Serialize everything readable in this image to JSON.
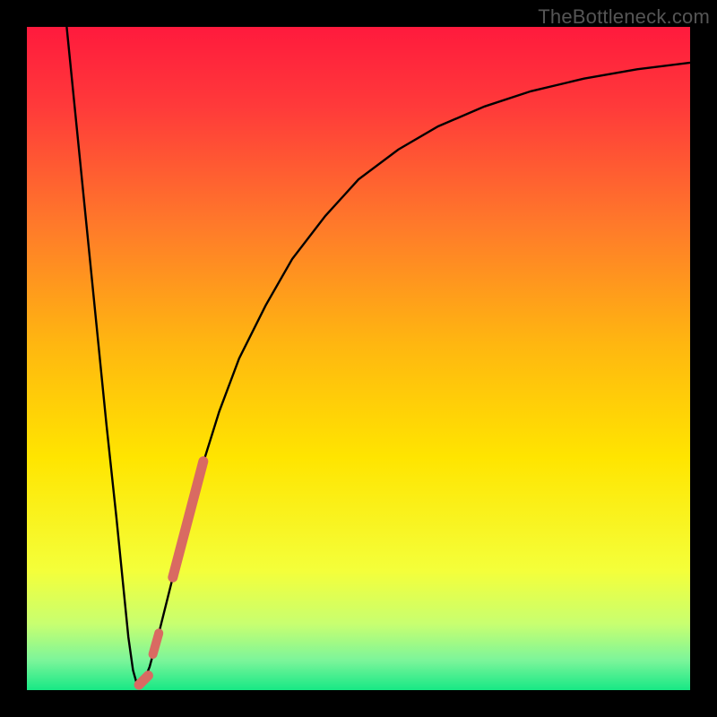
{
  "watermark": "TheBottleneck.com",
  "chart_data": {
    "type": "line",
    "title": "",
    "xlabel": "",
    "ylabel": "",
    "xlim": [
      0,
      100
    ],
    "ylim": [
      0,
      100
    ],
    "background_gradient": {
      "stops": [
        {
          "offset": 0.0,
          "color": "#ff1a3d"
        },
        {
          "offset": 0.12,
          "color": "#ff3a3a"
        },
        {
          "offset": 0.3,
          "color": "#ff7a2a"
        },
        {
          "offset": 0.48,
          "color": "#ffb710"
        },
        {
          "offset": 0.65,
          "color": "#ffe500"
        },
        {
          "offset": 0.82,
          "color": "#f4ff3a"
        },
        {
          "offset": 0.9,
          "color": "#c8ff70"
        },
        {
          "offset": 0.955,
          "color": "#7cf59a"
        },
        {
          "offset": 1.0,
          "color": "#17e885"
        }
      ]
    },
    "series": [
      {
        "name": "bottleneck-curve",
        "stroke": "#000000",
        "stroke_width": 2.4,
        "points": [
          {
            "x": 6.0,
            "y": 100.0
          },
          {
            "x": 7.5,
            "y": 85.0
          },
          {
            "x": 9.0,
            "y": 70.0
          },
          {
            "x": 10.5,
            "y": 55.0
          },
          {
            "x": 12.0,
            "y": 40.0
          },
          {
            "x": 13.5,
            "y": 26.0
          },
          {
            "x": 14.5,
            "y": 16.0
          },
          {
            "x": 15.3,
            "y": 8.0
          },
          {
            "x": 16.0,
            "y": 3.0
          },
          {
            "x": 16.7,
            "y": 0.5
          },
          {
            "x": 17.5,
            "y": 1.0
          },
          {
            "x": 18.5,
            "y": 3.5
          },
          {
            "x": 20.0,
            "y": 9.0
          },
          {
            "x": 22.0,
            "y": 17.0
          },
          {
            "x": 24.0,
            "y": 25.0
          },
          {
            "x": 26.5,
            "y": 34.0
          },
          {
            "x": 29.0,
            "y": 42.0
          },
          {
            "x": 32.0,
            "y": 50.0
          },
          {
            "x": 36.0,
            "y": 58.0
          },
          {
            "x": 40.0,
            "y": 65.0
          },
          {
            "x": 45.0,
            "y": 71.5
          },
          {
            "x": 50.0,
            "y": 77.0
          },
          {
            "x": 56.0,
            "y": 81.5
          },
          {
            "x": 62.0,
            "y": 85.0
          },
          {
            "x": 69.0,
            "y": 88.0
          },
          {
            "x": 76.0,
            "y": 90.3
          },
          {
            "x": 84.0,
            "y": 92.2
          },
          {
            "x": 92.0,
            "y": 93.6
          },
          {
            "x": 100.0,
            "y": 94.6
          }
        ]
      },
      {
        "name": "highlight-segment",
        "stroke": "#d96a62",
        "stroke_width": 11,
        "linecap": "round",
        "points": [
          {
            "x": 22.0,
            "y": 17.0
          },
          {
            "x": 26.6,
            "y": 34.5
          }
        ]
      },
      {
        "name": "highlight-dot-upper",
        "stroke": "#d96a62",
        "stroke_width": 10,
        "linecap": "round",
        "points": [
          {
            "x": 19.0,
            "y": 5.4
          },
          {
            "x": 19.9,
            "y": 8.6
          }
        ]
      },
      {
        "name": "highlight-dot-lower",
        "stroke": "#d96a62",
        "stroke_width": 11,
        "linecap": "round",
        "points": [
          {
            "x": 16.9,
            "y": 0.8
          },
          {
            "x": 18.3,
            "y": 2.2
          }
        ]
      }
    ]
  }
}
